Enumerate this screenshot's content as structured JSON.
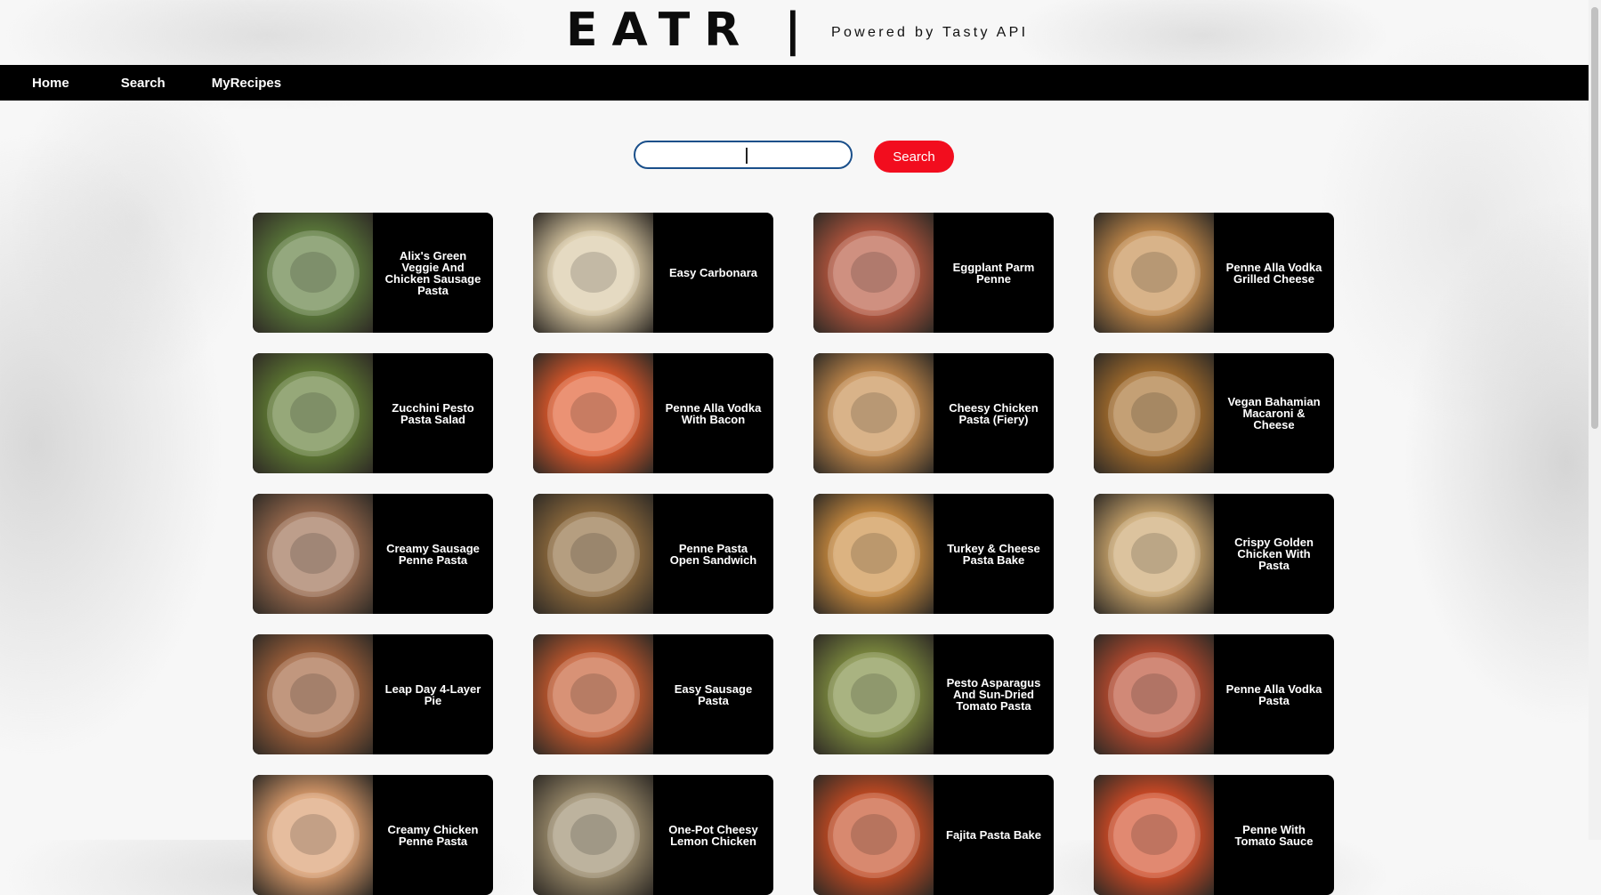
{
  "header": {
    "logo": "EATR |",
    "tagline": "Powered by Tasty API"
  },
  "nav": {
    "home": "Home",
    "search": "Search",
    "my_recipes": "MyRecipes"
  },
  "search": {
    "value": "",
    "button_label": "Search"
  },
  "recipes": [
    {
      "title": "Alix's Green Veggie And Chicken Sausage Pasta",
      "color": "#5b7a3a"
    },
    {
      "title": "Easy Carbonara",
      "color": "#d8c7a2"
    },
    {
      "title": "Eggplant Parm Penne",
      "color": "#b5553d"
    },
    {
      "title": "Penne Alla Vodka Grilled Cheese",
      "color": "#c48a4a"
    },
    {
      "title": "Zucchini Pesto Pasta Salad",
      "color": "#5e7a32"
    },
    {
      "title": "Penne Alla Vodka With Bacon",
      "color": "#e0582a"
    },
    {
      "title": "Cheesy Chicken Pasta (Fiery)",
      "color": "#c58a4b"
    },
    {
      "title": "Vegan Bahamian Macaroni & Cheese",
      "color": "#a56d2c"
    },
    {
      "title": "Creamy Sausage Penne Pasta",
      "color": "#9a6a4d"
    },
    {
      "title": "Penne Pasta Open Sandwich",
      "color": "#8e6a3c"
    },
    {
      "title": "Turkey & Cheese Pasta Bake",
      "color": "#c98a3e"
    },
    {
      "title": "Crispy Golden Chicken With Pasta",
      "color": "#c9a46b"
    },
    {
      "title": "Leap Day 4-Layer Pie",
      "color": "#a0603a"
    },
    {
      "title": "Easy Sausage Pasta",
      "color": "#c4582d"
    },
    {
      "title": "Pesto Asparagus And Sun-Dried Tomato Pasta",
      "color": "#7c8a3e"
    },
    {
      "title": "Penne Alla Vodka Pasta",
      "color": "#b94a2e"
    },
    {
      "title": "Creamy Chicken Penne Pasta",
      "color": "#d99a6a"
    },
    {
      "title": "One-Pot Cheesy Lemon Chicken",
      "color": "#9a8a6a"
    },
    {
      "title": "Fajita Pasta Bake",
      "color": "#c44a22"
    },
    {
      "title": "Penne With Tomato Sauce",
      "color": "#d24a25"
    }
  ]
}
